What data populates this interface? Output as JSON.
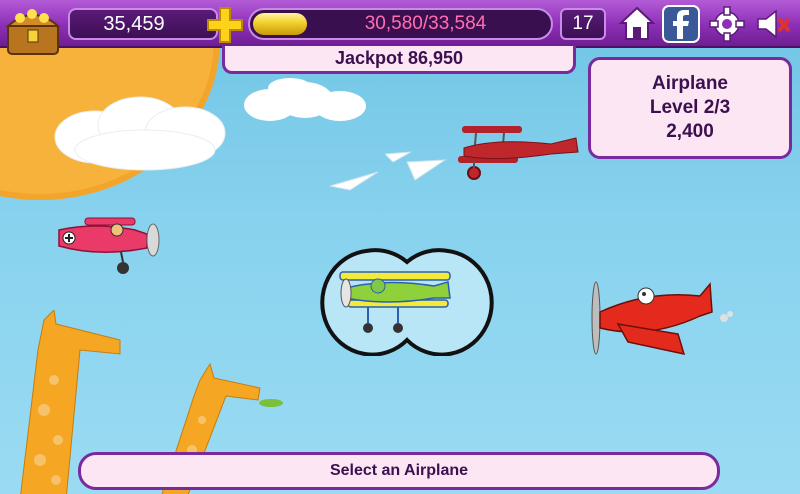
{
  "hud": {
    "coins": "35,459",
    "xp_text": "30,580/33,584",
    "xp_progress": 0.2,
    "level": "17"
  },
  "jackpot": {
    "label": "Jackpot 86,950"
  },
  "info": {
    "name": "Airplane",
    "level": "Level 2/3",
    "value": "2,400"
  },
  "footer": {
    "label": "Select an Airplane"
  },
  "icons": [
    "chest-icon",
    "plus-icon",
    "home-icon",
    "facebook-icon",
    "gear-icon",
    "mute-icon"
  ],
  "colors": {
    "hud_purple": "#8d2fb6",
    "panel_bg": "#fde6f3",
    "panel_border": "#7a2a9e",
    "xp_text": "#ff6fb0",
    "sky": "#88d2ee",
    "sun": "#f6b23a"
  }
}
